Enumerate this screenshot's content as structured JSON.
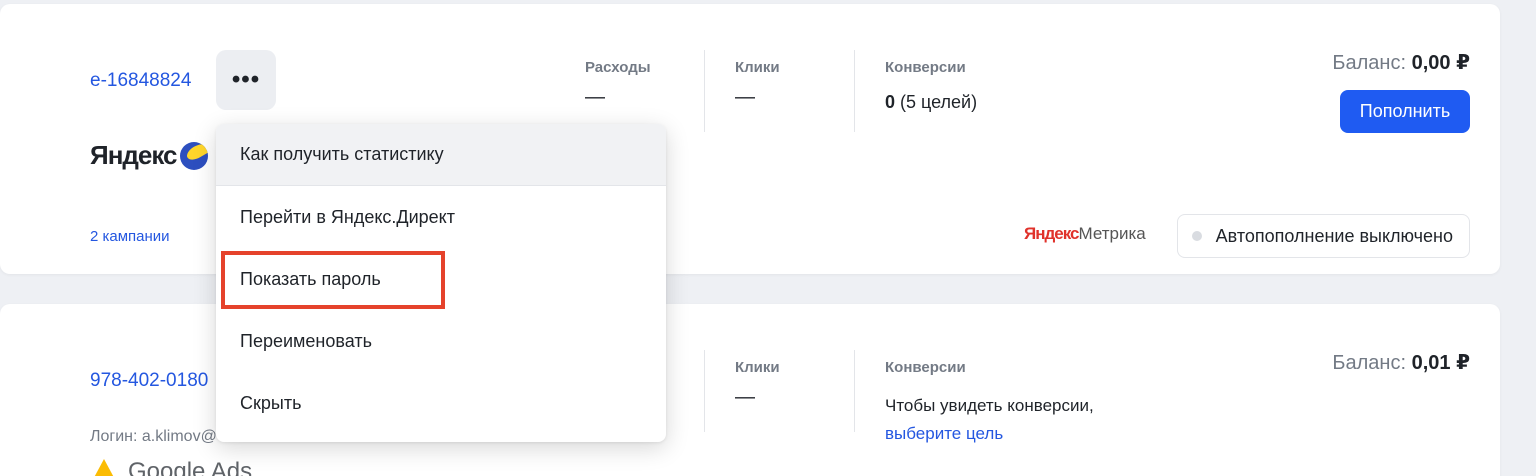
{
  "accounts": [
    {
      "id": "e-16848824",
      "platform": "Яндекс",
      "campaigns": "2 кампании",
      "stats": {
        "expenses_label": "Расходы",
        "expenses_value": "—",
        "clicks_label": "Клики",
        "clicks_value": "—",
        "conversions_label": "Конверсии",
        "conversions_value": "0",
        "conversions_goals": " (5 целей)"
      },
      "balance_label": "Баланс: ",
      "balance_value": "0,00 ₽",
      "topup_label": "Пополнить",
      "metrika_ya": "Яндекс",
      "metrika_text": "Метрика",
      "autopay_label": "Автопополнение выключено"
    },
    {
      "id": "978-402-0180",
      "login": "Логин: a.klimov@",
      "platform": "Google Ads",
      "stats": {
        "clicks_label": "Клики",
        "clicks_value": "—",
        "conversions_label": "Конверсии",
        "conversions_hint": "Чтобы увидеть конверсии,",
        "conversions_link": "выберите цель"
      },
      "balance_label": "Баланс: ",
      "balance_value": "0,01 ₽"
    }
  ],
  "more_button": "•••",
  "menu": {
    "items": [
      {
        "label": "Как получить статистику"
      },
      {
        "label": "Перейти в Яндекс.Директ"
      },
      {
        "label": "Показать пароль"
      },
      {
        "label": "Переименовать"
      },
      {
        "label": "Скрыть"
      }
    ]
  },
  "colors": {
    "accent": "#1f5bf2",
    "link": "#2457e0",
    "highlight": "#e5422b"
  }
}
